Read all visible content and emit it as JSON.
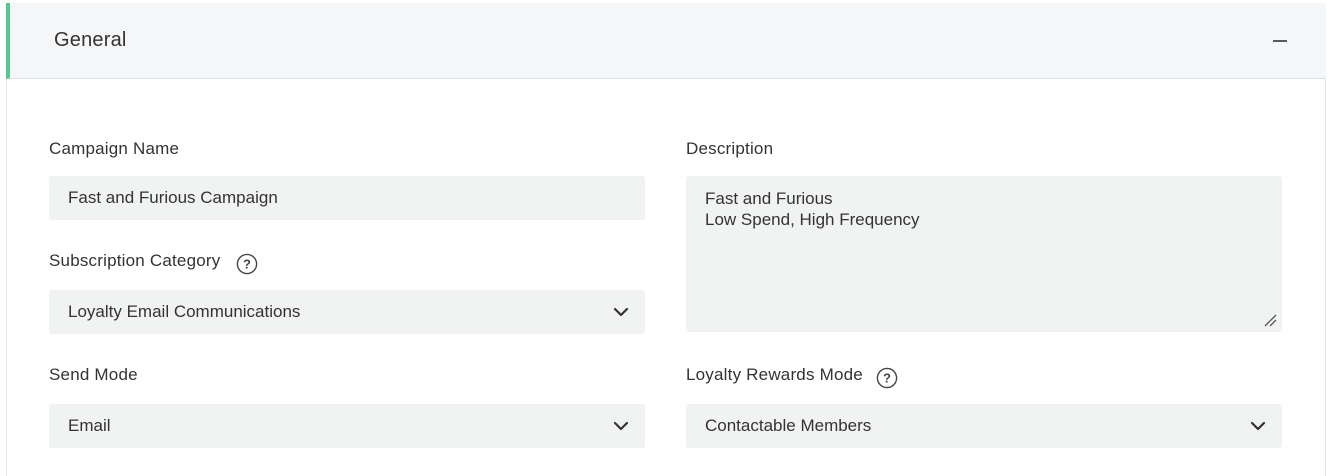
{
  "section": {
    "title": "General",
    "collapse_icon": "minus-icon"
  },
  "fields": {
    "campaign_name": {
      "label": "Campaign Name",
      "value": "Fast and Furious Campaign"
    },
    "description": {
      "label": "Description",
      "lines": [
        "Fast and Furious",
        "Low Spend, High Frequency"
      ]
    },
    "subscription_category": {
      "label": "Subscription Category",
      "value": "Loyalty Email Communications",
      "help_icon": "question-circle-icon"
    },
    "send_mode": {
      "label": "Send Mode",
      "value": "Email"
    },
    "loyalty_rewards_mode": {
      "label": "Loyalty Rewards Mode",
      "value": "Contactable Members",
      "help_icon": "question-circle-icon"
    }
  },
  "colors": {
    "accent": "#54c88f",
    "header_bg": "#f5f6f7",
    "input_bg": "#f1f2f2",
    "text": "#333333"
  }
}
